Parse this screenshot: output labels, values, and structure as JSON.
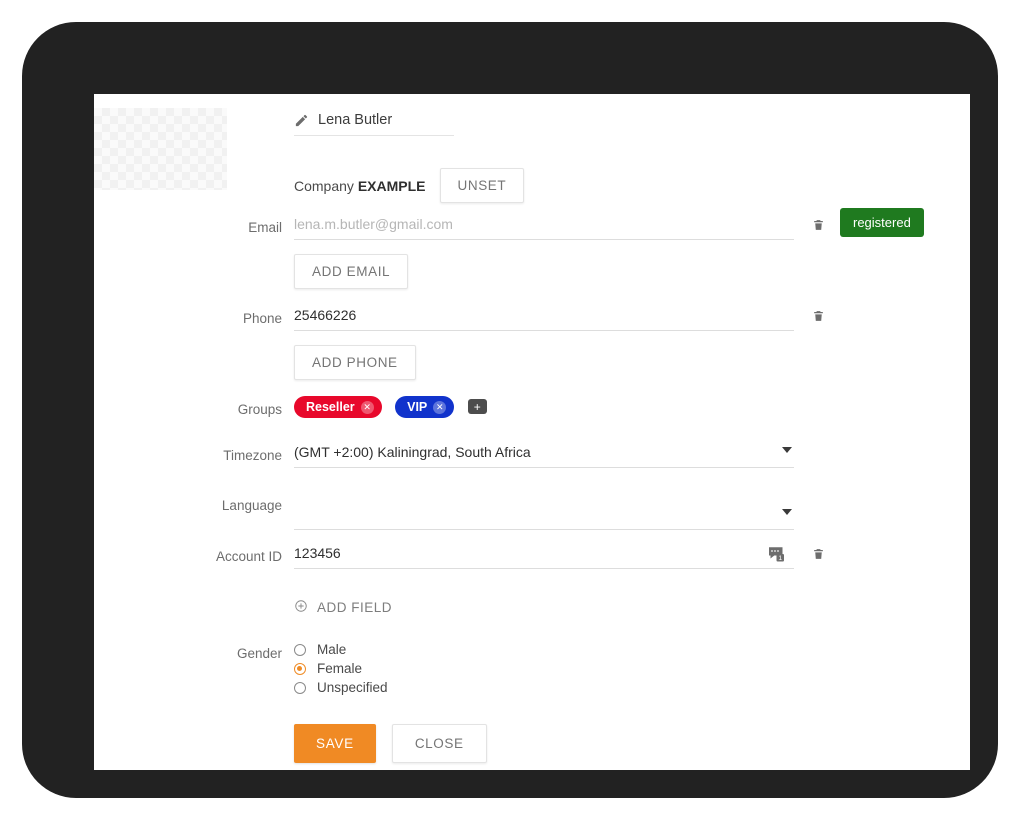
{
  "profile": {
    "name": "Lena Butler",
    "edit_icon": "pencil-icon",
    "avatar_alt": "avatar-placeholder"
  },
  "company": {
    "label": "Company",
    "value": "EXAMPLE",
    "unset_label": "UNSET"
  },
  "fields": {
    "email": {
      "label": "Email",
      "value": "lena.m.butler@gmail.com",
      "placeholder": "lena.m.butler@gmail.com",
      "add_label": "ADD EMAIL",
      "status_badge": "registered",
      "badge_color": "#1f7a1f",
      "delete_icon": "trash-icon"
    },
    "phone": {
      "label": "Phone",
      "value": "25466226",
      "add_label": "ADD PHONE",
      "delete_icon": "trash-icon"
    },
    "groups": {
      "label": "Groups",
      "chips": [
        {
          "label": "Reseller",
          "color": "#e8082b",
          "remove_icon": "close-circle-icon"
        },
        {
          "label": "VIP",
          "color": "#1133cc",
          "remove_icon": "close-circle-icon"
        }
      ],
      "add_icon": "plus-tag-icon"
    },
    "timezone": {
      "label": "Timezone",
      "value": "(GMT +2:00) Kaliningrad, South Africa",
      "caret_icon": "chevron-down-icon"
    },
    "language": {
      "label": "Language",
      "value": "",
      "caret_icon": "chevron-down-icon"
    },
    "account_id": {
      "label": "Account ID",
      "value": "123456",
      "comment_icon": "comment-badge-icon",
      "comment_count": "1",
      "delete_icon": "trash-icon"
    },
    "add_field": {
      "label": "ADD FIELD",
      "icon": "plus-circle-icon"
    },
    "gender": {
      "label": "Gender",
      "options": [
        {
          "label": "Male",
          "selected": false
        },
        {
          "label": "Female",
          "selected": true
        },
        {
          "label": "Unspecified",
          "selected": false
        }
      ],
      "accent_color": "#ef8c26"
    }
  },
  "actions": {
    "save_label": "SAVE",
    "close_label": "CLOSE",
    "save_color": "#f08a24"
  }
}
